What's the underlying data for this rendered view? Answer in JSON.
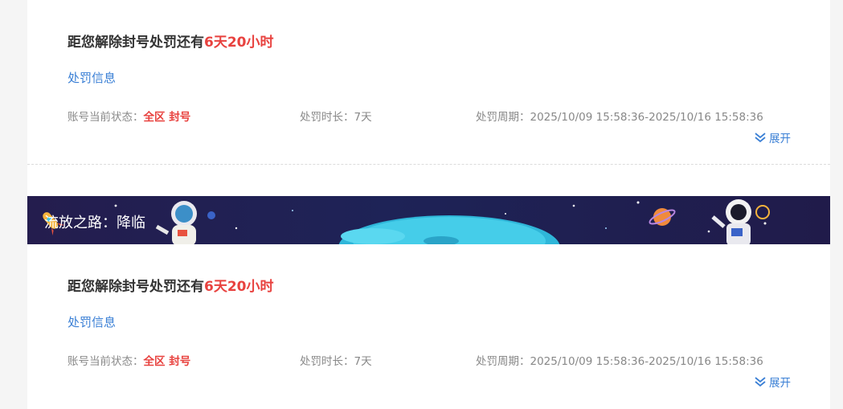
{
  "cards": [
    {
      "title_prefix": "距您解除封号处罚还有",
      "title_highlight": "6天20小时",
      "link": "处罚信息",
      "status_label": "账号当前状态：",
      "status_value": "全区 封号",
      "duration": "处罚时长：7天",
      "period": "处罚周期：2025/10/09 15:58:36-2025/10/16 15:58:36",
      "expand": "展开"
    },
    {
      "title_prefix": "距您解除封号处罚还有",
      "title_highlight": "6天20小时",
      "link": "处罚信息",
      "status_label": "账号当前状态：",
      "status_value": "全区 封号",
      "duration": "处罚时长：7天",
      "period": "处罚周期：2025/10/09 15:58:36-2025/10/16 15:58:36",
      "expand": "展开"
    }
  ],
  "banner": {
    "title": "流放之路：降临"
  },
  "colors": {
    "accent_red": "#e8423f",
    "link_blue": "#3a7fd5",
    "banner_bg": "#1e2357"
  }
}
